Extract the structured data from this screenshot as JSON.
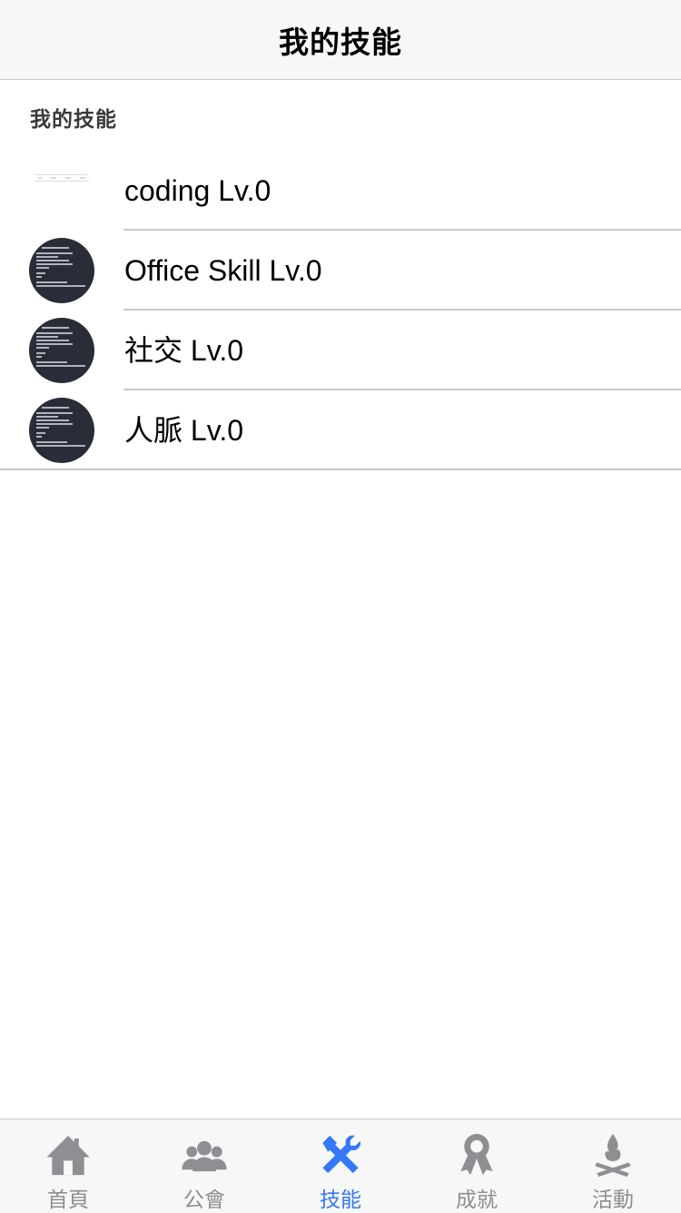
{
  "nav": {
    "title": "我的技能"
  },
  "section": {
    "header": "我的技能"
  },
  "skills": [
    {
      "label": "coding Lv.0",
      "avatar": "blank-image"
    },
    {
      "label": "Office Skill Lv.0",
      "avatar": "code-screenshot"
    },
    {
      "label": "社交 Lv.0",
      "avatar": "code-screenshot"
    },
    {
      "label": "人脈 Lv.0",
      "avatar": "code-screenshot"
    }
  ],
  "tabs": [
    {
      "label": "首頁",
      "icon": "home-icon",
      "active": false
    },
    {
      "label": "公會",
      "icon": "group-icon",
      "active": false
    },
    {
      "label": "技能",
      "icon": "tools-icon",
      "active": true
    },
    {
      "label": "成就",
      "icon": "award-icon",
      "active": false
    },
    {
      "label": "活動",
      "icon": "campfire-icon",
      "active": false
    }
  ],
  "colors": {
    "accent": "#3478f6",
    "inactive": "#8e8e93",
    "bar_bg": "#f7f7f7",
    "separator": "#c8c8cc"
  }
}
